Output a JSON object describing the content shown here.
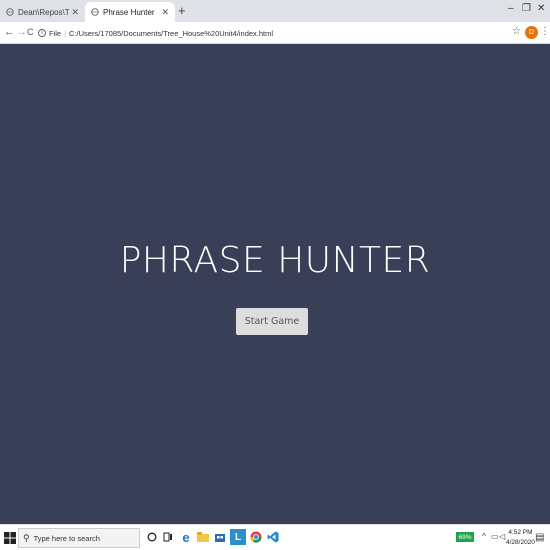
{
  "browser": {
    "tabs": [
      {
        "title": "Dean\\Repos\\Treehouse-project",
        "active": false
      },
      {
        "title": "Phrase Hunter",
        "active": true
      }
    ],
    "new_tab_label": "+",
    "window_controls": {
      "minimize": "–",
      "maximize": "❐",
      "close": "✕"
    },
    "nav": {
      "back": "←",
      "forward": "→",
      "reload": "C"
    },
    "url": {
      "scheme_label": "File",
      "path": "C:/Users/17085/Documents/Tree_House%20Unit4/index.html"
    },
    "profile_initial": "D"
  },
  "page": {
    "title": "PHRASE HUNTER",
    "start_button": "Start Game",
    "background_color": "#3a3f58"
  },
  "taskbar": {
    "search_placeholder": "Type here to search",
    "battery": "69%",
    "time": "4:52 PM",
    "date": "4/28/2020",
    "icons": [
      "cortana-icon",
      "task-view-icon",
      "edge-icon",
      "file-explorer-icon",
      "store-icon",
      "lync-icon",
      "chrome-icon",
      "vscode-icon"
    ]
  }
}
